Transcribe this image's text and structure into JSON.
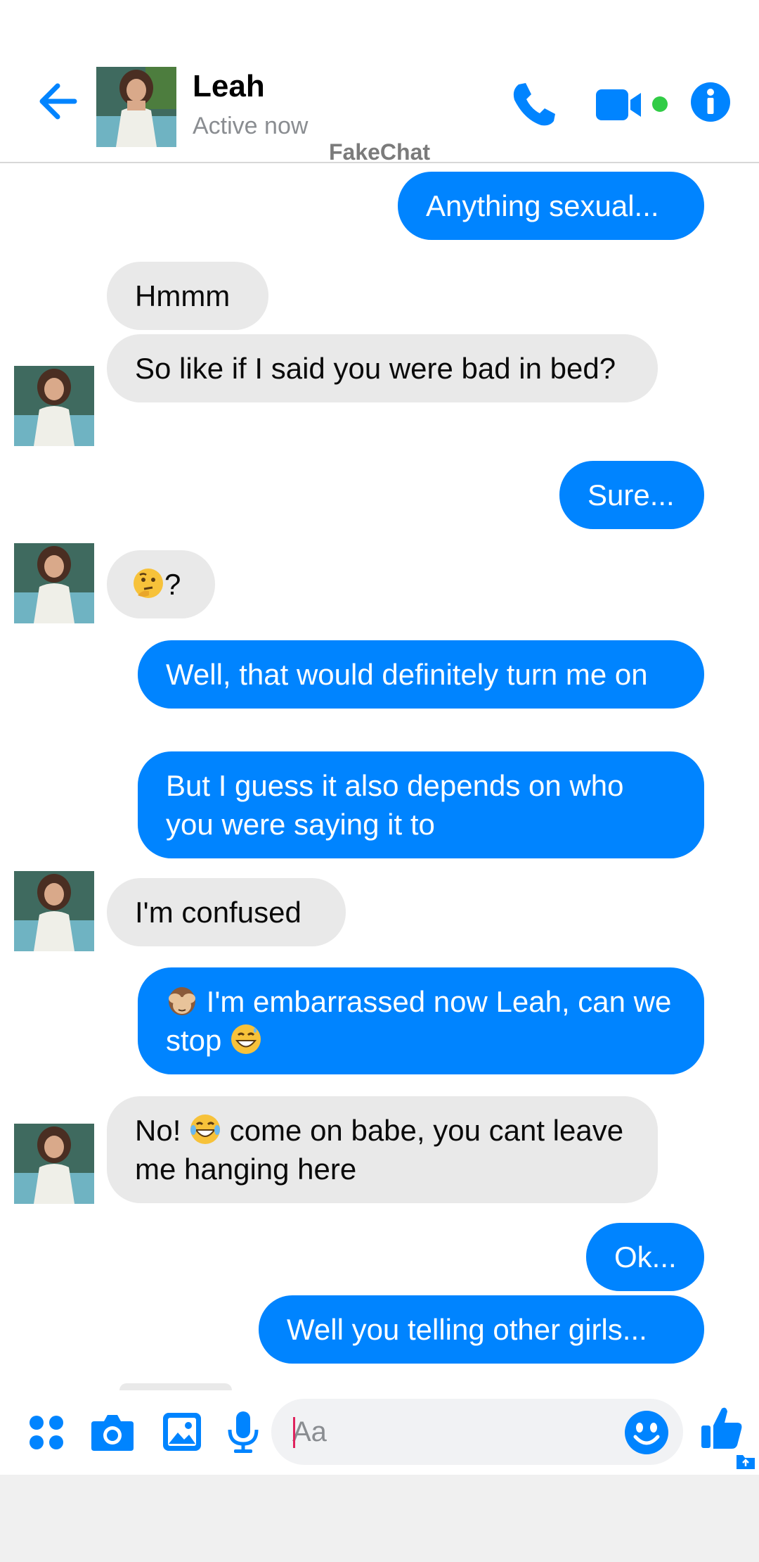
{
  "header": {
    "contact_name": "Leah",
    "status": "Active now",
    "watermark": "FakeChat",
    "icons": {
      "back": "arrow-left-icon",
      "call": "phone-icon",
      "video": "video-camera-icon",
      "info": "info-icon",
      "active": "online-dot"
    }
  },
  "colors": {
    "accent": "#0084ff",
    "received_bubble": "#e9e9e9",
    "online": "#31cc46"
  },
  "messages": [
    {
      "direction": "sent",
      "text": "Anything sexual..."
    },
    {
      "direction": "received",
      "text": "Hmmm"
    },
    {
      "direction": "received",
      "text": "So like if I said you were bad in bed?"
    },
    {
      "direction": "sent",
      "text": "Sure..."
    },
    {
      "direction": "received",
      "emoji": "thinking-face",
      "text": "?"
    },
    {
      "direction": "sent",
      "text": "Well, that would definitely turn me on"
    },
    {
      "direction": "sent",
      "text": "But I guess it also depends on who you were saying it to"
    },
    {
      "direction": "received",
      "text": "I'm confused"
    },
    {
      "direction": "sent",
      "emoji_lead": "see-no-evil-monkey",
      "text": "I'm embarrassed now Leah, can we stop",
      "emoji_trail": "grinning-sweat-face"
    },
    {
      "direction": "received",
      "text_before": "No!",
      "emoji": "tears-of-joy-face",
      "text_after": "come on babe, you cant leave me hanging here"
    },
    {
      "direction": "sent",
      "text": "Ok..."
    },
    {
      "direction": "sent",
      "text": "Well you telling other girls..."
    }
  ],
  "composer": {
    "placeholder": "Aa",
    "icons": [
      "apps-icon",
      "camera-icon",
      "gallery-icon",
      "microphone-icon",
      "emoji-icon",
      "thumbs-up-icon"
    ]
  }
}
